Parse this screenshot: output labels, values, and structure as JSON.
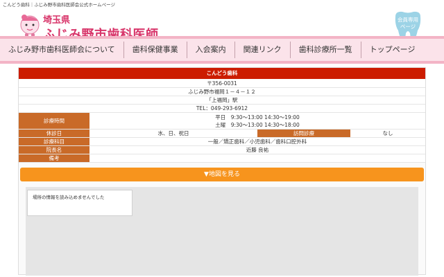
{
  "topbar": {
    "text": "こんどう歯科｜ふじみ野市歯科医師会公式ホームページ"
  },
  "logo": {
    "prefecture": "埼玉県",
    "name": "ふじみ野市歯科医師会"
  },
  "member_page": {
    "line1": "会員専用",
    "line2": "ページ"
  },
  "nav": [
    "ふじみ野市歯科医師会について",
    "歯科保健事業",
    "入会案内",
    "関連リンク",
    "歯科診療所一覧",
    "トップページ"
  ],
  "clinic": {
    "name": "こんどう歯科",
    "postal": "〒356-0031",
    "address": "ふじみ野市福岡１－４－１２",
    "station": "「上福岡」駅",
    "tel": "TEL：049-293-6912",
    "hours_label": "診療時間",
    "hours": [
      "平日　9:30～13:00 14:30～19:00",
      "土曜　9:30～13:00 14:30～18:00"
    ],
    "closed_label": "休診日",
    "closed_value": "水、日、祝日",
    "visit_label": "訪問診療",
    "visit_value": "なし",
    "subjects_label": "診療科目",
    "subjects_value": "一般／矯正歯科／小児歯科／歯科口腔外科",
    "director_label": "院長名",
    "director_value": "近藤 良祐",
    "notes_label": "備考",
    "notes_value": ""
  },
  "map": {
    "button_label": "▼地図を見る",
    "error_message": "場所の情報を読み込めませんでした"
  },
  "colors": {
    "pink": "#d8356a",
    "clinic_header": "#cc1c00",
    "label_bg": "#c96a28",
    "map_button": "#f7941d"
  }
}
